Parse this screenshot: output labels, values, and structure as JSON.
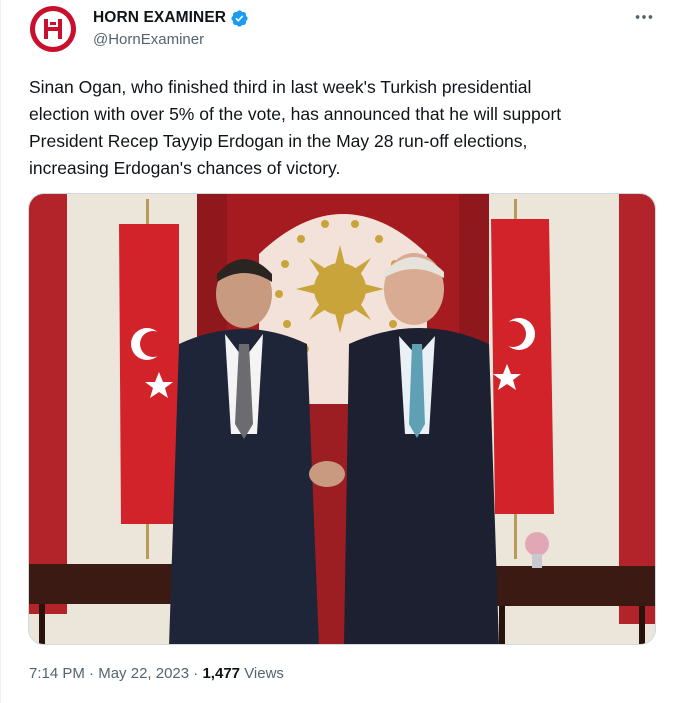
{
  "author": {
    "display_name": "HORN EXAMINER",
    "handle": "@HornExaminer",
    "avatar_icon": "horn-examiner-logo-icon",
    "verified_icon": "verified-badge-icon",
    "brand_color": "#c8102e",
    "verified_color": "#1d9bf0"
  },
  "menu": {
    "icon": "more-options-icon"
  },
  "tweet": {
    "text": "Sinan Ogan, who finished third in last week's Turkish presidential\nelection with over 5% of the vote, has announced that he will support\nPresident Recep Tayyip Erdogan in the May 28 run-off elections,\nincreasing Erdogan's chances of victory."
  },
  "media": {
    "type": "photo",
    "colors": {
      "flag_red": "#d2232a",
      "curtain_red": "#a61b1f",
      "wall": "#ece6da",
      "gold": "#c9a43a"
    }
  },
  "meta": {
    "time": "7:14 PM",
    "separator": "·",
    "date": "May 22, 2023",
    "views_count": "1,477",
    "views_label": "Views"
  }
}
